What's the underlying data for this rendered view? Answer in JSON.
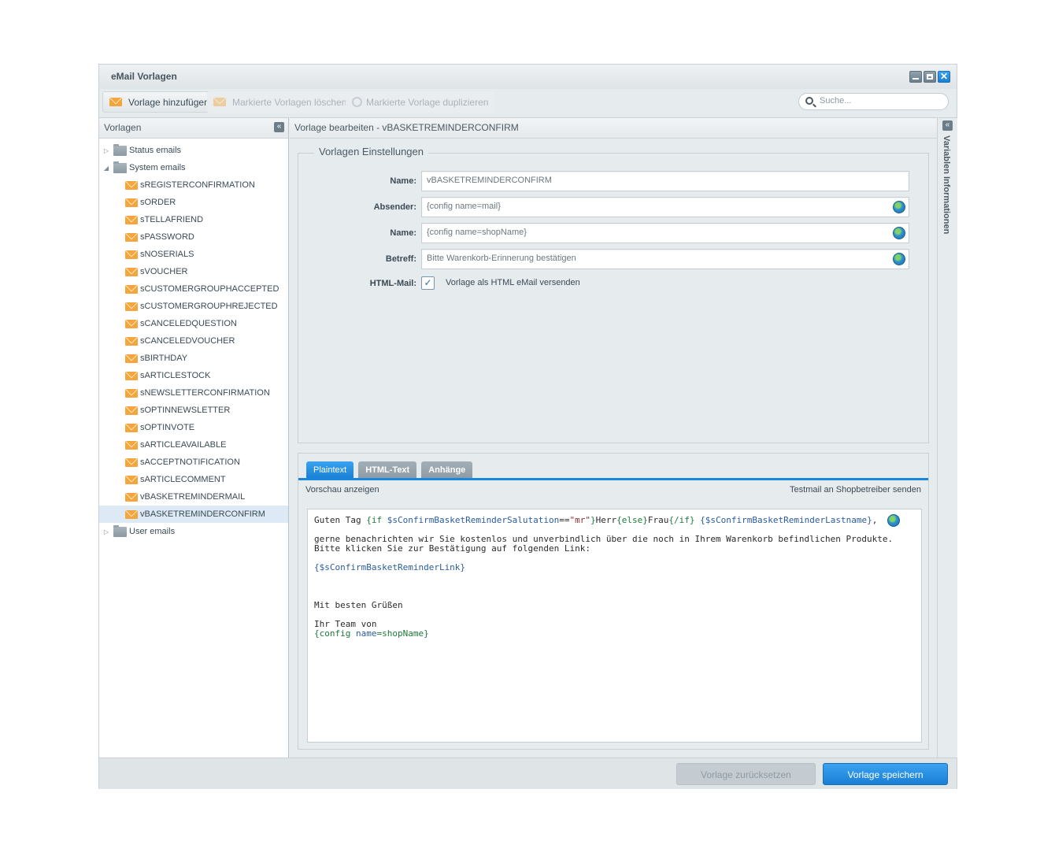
{
  "window": {
    "title": "eMail Vorlagen"
  },
  "toolbar": {
    "add_label": "Vorlage hinzufügen",
    "delete_label": "Markierte Vorlagen löschen",
    "duplicate_label": "Markierte Vorlage duplizieren",
    "search_placeholder": "Suche..."
  },
  "sidebar": {
    "title": "Vorlagen",
    "folders": {
      "status": "Status emails",
      "system": "System emails",
      "user": "User emails"
    },
    "system_items": [
      "sREGISTERCONFIRMATION",
      "sORDER",
      "sTELLAFRIEND",
      "sPASSWORD",
      "sNOSERIALS",
      "sVOUCHER",
      "sCUSTOMERGROUPHACCEPTED",
      "sCUSTOMERGROUPHREJECTED",
      "sCANCELEDQUESTION",
      "sCANCELEDVOUCHER",
      "sBIRTHDAY",
      "sARTICLESTOCK",
      "sNEWSLETTERCONFIRMATION",
      "sOPTINNEWSLETTER",
      "sOPTINVOTE",
      "sARTICLEAVAILABLE",
      "sACCEPTNOTIFICATION",
      "sARTICLECOMMENT",
      "vBASKETREMINDERMAIL",
      "vBASKETREMINDERCONFIRM"
    ],
    "selected": "vBASKETREMINDERCONFIRM"
  },
  "main": {
    "title": "Vorlage bearbeiten - vBASKETREMINDERCONFIRM",
    "settings_legend": "Vorlagen Einstellungen",
    "fields": {
      "name_label": "Name:",
      "name_value": "vBASKETREMINDERCONFIRM",
      "sender_label": "Absender:",
      "sender_value": "{config name=mail}",
      "sender_name_label": "Name:",
      "sender_name_value": "{config name=shopName}",
      "subject_label": "Betreff:",
      "subject_value": "Bitte Warenkorb-Erinnerung bestätigen",
      "html_label": "HTML-Mail:",
      "html_checkbox_label": "Vorlage als HTML eMail versenden",
      "html_checked": true
    },
    "tabs": [
      "Plaintext",
      "HTML-Text",
      "Anhänge"
    ],
    "active_tab": "Plaintext",
    "preview_label": "Vorschau anzeigen",
    "testmail_label": "Testmail an Shopbetreiber senden",
    "editor": {
      "line1_a": "Guten Tag ",
      "line1_b": "{if ",
      "line1_c": "$sConfirmBasketReminderSalutation",
      "line1_d": "==",
      "line1_e": "\"mr\"",
      "line1_f": "}",
      "line1_g": "Herr",
      "line1_h": "{else}",
      "line1_i": "Frau",
      "line1_j": "{/if}",
      "line1_k": " ",
      "line1_l": "{$sConfirmBasketReminderLastname}",
      "line1_m": ",",
      "line2": "gerne benachrichten wir Sie kostenlos und unverbindlich über die noch in Ihrem Warenkorb befindlichen Produkte.",
      "line3": "Bitte klicken Sie zur Bestätigung auf folgenden Link:",
      "line4": "{$sConfirmBasketReminderLink}",
      "line5": "Mit besten Grüßen",
      "line6": "Ihr Team von",
      "line7_a": "{config ",
      "line7_b": "name",
      "line7_c": "=shopName}"
    }
  },
  "rightbar": {
    "title": "Variablen Informationen"
  },
  "footer": {
    "reset_label": "Vorlage zurücksetzen",
    "save_label": "Vorlage speichern"
  }
}
